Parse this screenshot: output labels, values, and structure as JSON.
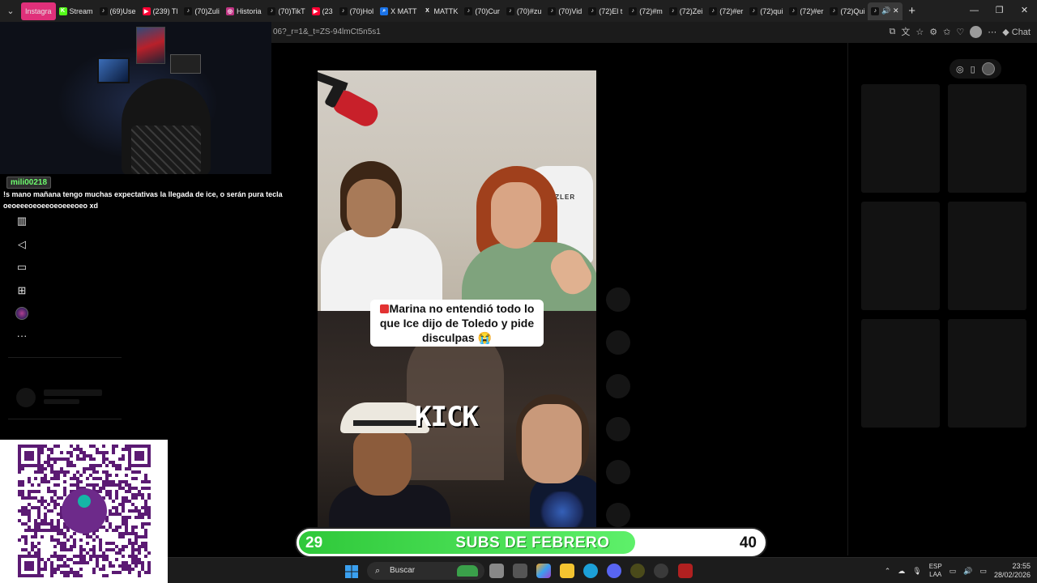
{
  "browser": {
    "tabs": [
      {
        "label": "Instagra",
        "pill": true,
        "fav_color": "#e0307a"
      },
      {
        "label": "Stream",
        "fav_color": "#53fc18",
        "fav_glyph": "K"
      },
      {
        "label": "(69)Use",
        "fav_color": "#111111",
        "fav_glyph": "♪"
      },
      {
        "label": "(239) Tl",
        "fav_color": "#ff0033",
        "fav_glyph": "▶"
      },
      {
        "label": "(70)Zuli",
        "fav_color": "#111111",
        "fav_glyph": "♪"
      },
      {
        "label": "Historia",
        "fav_color": "#c13584",
        "fav_glyph": "◎"
      },
      {
        "label": "(70)TikT",
        "fav_color": "#111111",
        "fav_glyph": "♪"
      },
      {
        "label": "(23",
        "fav_color": "#ff0033",
        "fav_glyph": "▶"
      },
      {
        "label": "(70)Hol",
        "fav_color": "#111111",
        "fav_glyph": "♪"
      },
      {
        "label": "X MATT",
        "fav_color": "#1a73e8",
        "fav_glyph": "⌕"
      },
      {
        "label": "MATTK",
        "fav_color": "#222222",
        "fav_glyph": "X"
      },
      {
        "label": "(70)Cur",
        "fav_color": "#111111",
        "fav_glyph": "♪"
      },
      {
        "label": "(70)#zu",
        "fav_color": "#111111",
        "fav_glyph": "♪"
      },
      {
        "label": "(70)Vid",
        "fav_color": "#111111",
        "fav_glyph": "♪"
      },
      {
        "label": "(72)El t",
        "fav_color": "#111111",
        "fav_glyph": "♪"
      },
      {
        "label": "(72)#m",
        "fav_color": "#111111",
        "fav_glyph": "♪"
      },
      {
        "label": "(72)Zei",
        "fav_color": "#111111",
        "fav_glyph": "♪"
      },
      {
        "label": "(72)#er",
        "fav_color": "#111111",
        "fav_glyph": "♪"
      },
      {
        "label": "(72)qui",
        "fav_color": "#111111",
        "fav_glyph": "♪"
      },
      {
        "label": "(72)#er",
        "fav_color": "#111111",
        "fav_glyph": "♪"
      },
      {
        "label": "(72)Qui",
        "fav_color": "#111111",
        "fav_glyph": "♪"
      },
      {
        "label": "",
        "active": true,
        "fav_color": "#111111",
        "fav_glyph": "♪"
      }
    ],
    "url": "06?_r=1&_t=ZS-94lmCt5n5s1",
    "chat_label": "Chat"
  },
  "chat": {
    "username": "mili00218",
    "message": "!s mano mañana tengo muchas expectativas la llegada de ice, o serán pura tecla oeoeeeoeoeeoeoeeeoeo xd"
  },
  "video": {
    "caption": "Marina no entendió todo lo que Ice dijo de Toledo y pide disculpas 😭",
    "watermark": "KICK",
    "chair_brand": "OZLER"
  },
  "subs": {
    "current": "29",
    "goal": "40",
    "title": "SUBS DE FEBRERO",
    "progress": 0.725,
    "fill_color": "#3ad144"
  },
  "taskbar": {
    "search_label": "Buscar",
    "language": "ESP",
    "layout": "LAA",
    "time": "23:55",
    "date": "28/02/2026"
  }
}
